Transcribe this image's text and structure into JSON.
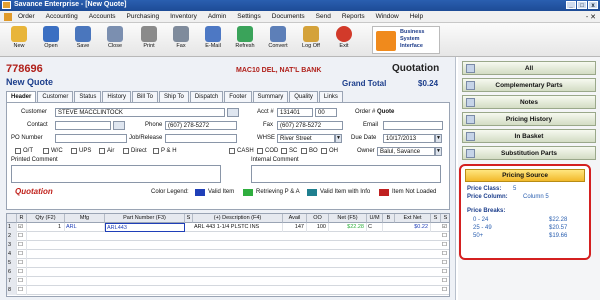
{
  "window": {
    "title": "Savance Enterprise - [New Quote]",
    "controls": [
      "_",
      "□",
      "x"
    ]
  },
  "menu": [
    "Order",
    "Accounting",
    "Accounts",
    "Purchasing",
    "Inventory",
    "Admin",
    "Settings",
    "Documents",
    "Send",
    "Reports",
    "Window",
    "Help"
  ],
  "menu_right": "- ✕",
  "toolbar": [
    {
      "label": "New",
      "icon": "new-doc-icon",
      "color": "#e8b53a"
    },
    {
      "label": "Open",
      "icon": "open-folder-icon",
      "color": "#3b6fc2"
    },
    {
      "label": "Save",
      "icon": "save-icon",
      "color": "#4a76bd"
    },
    {
      "label": "Close",
      "icon": "close-doc-icon",
      "color": "#7b8fb0"
    },
    {
      "label": "Print",
      "icon": "printer-icon",
      "color": "#8a8a8a"
    },
    {
      "label": "Fax",
      "icon": "fax-icon",
      "color": "#7f8b9c"
    },
    {
      "label": "E-Mail",
      "icon": "email-icon",
      "color": "#4d78c4"
    },
    {
      "label": "Refresh",
      "icon": "refresh-icon",
      "color": "#3aa35a"
    },
    {
      "label": "Convert",
      "icon": "convert-icon",
      "color": "#5d7fb8"
    },
    {
      "label": "Log Off",
      "icon": "logoff-icon",
      "color": "#d4a23a"
    },
    {
      "label": "Exit",
      "icon": "exit-icon",
      "color": "#d23a2a"
    }
  ],
  "logo_text": "Business System Interface",
  "header": {
    "quote_number": "778696",
    "title": "New Quote",
    "customer_banner": "MAC10   DEL, NAT'L BANK",
    "doc_type": "Quotation",
    "grand_total_label": "Grand Total",
    "grand_total": "$0.24"
  },
  "tabs": [
    "Header",
    "Customer",
    "Status",
    "History",
    "Bill To",
    "Ship To",
    "Dispatch",
    "Footer",
    "Summary",
    "Quality",
    "Links"
  ],
  "form": {
    "customer_label": "Customer",
    "customer": "STEVE MACCLINTOCK",
    "contact_label": "Contact",
    "contact": "",
    "phone_label": "Phone",
    "phone": "(607) 278-5272",
    "po_label": "PO Number",
    "po": "",
    "job_label": "Job/Release",
    "job": "",
    "acct_label": "Acct #",
    "acct": "131401",
    "acct_sub": "00",
    "order_label": "Order #",
    "order": "Quote",
    "fax_label": "Fax",
    "fax": "(607) 278-5272",
    "email_label": "Email",
    "email": "",
    "whse_label": "WHSE",
    "whse": "River Street",
    "due_label": "Due Date",
    "due": "10/17/2013",
    "owner_label": "Owner",
    "owner": "Balul, Savance",
    "ship_checks": [
      "O/T",
      "W/C",
      "UPS",
      "Air",
      "Direct",
      "P & H"
    ],
    "pay_checks": [
      "CASH",
      "COD",
      "SC",
      "BO",
      "OH"
    ],
    "printed_comment_label": "Printed Comment",
    "internal_comment_label": "Internal Comment",
    "doc_label": "Quotation"
  },
  "legend": {
    "label": "Color Legend:",
    "items": [
      {
        "text": "Valid Item",
        "color": "#1f3fb8"
      },
      {
        "text": "Retrieving P & A",
        "color": "#2fae3e"
      },
      {
        "text": "Valid Item with Info",
        "color": "#1f7f8f"
      },
      {
        "text": "Item Not Loaded",
        "color": "#c02020"
      }
    ]
  },
  "grid": {
    "columns": [
      "R",
      "Qty (F2)",
      "Mfg",
      "Part Number (F3)",
      "S",
      "(+) Description (F4)",
      "Avail",
      "OO",
      "Net (F5)",
      "U/M",
      "B",
      "Ext Net",
      "S",
      "S"
    ],
    "rows": [
      {
        "num": "1",
        "qty": "1",
        "mfg": "ARL",
        "part": "ARL443",
        "desc": "ARL 443 1-1/4 PLSTC INS",
        "avail": "147",
        "oo": "100",
        "net": "$22.28",
        "um": "C",
        "ext": "$0.22"
      },
      {
        "num": "2"
      },
      {
        "num": "3"
      },
      {
        "num": "4"
      },
      {
        "num": "5"
      },
      {
        "num": "6"
      },
      {
        "num": "7"
      },
      {
        "num": "8"
      }
    ]
  },
  "side": {
    "buttons": [
      "All",
      "Complementary Parts",
      "Notes",
      "Pricing History",
      "In Basket",
      "Substitution Parts"
    ],
    "pricing_source": {
      "title": "Pricing Source",
      "class_label": "Price Class:",
      "class_value": "5",
      "column_label": "Price Column:",
      "column_value": "Column 5",
      "breaks_label": "Price Breaks:",
      "breaks": [
        {
          "range": "0 - 24",
          "price": "$22.28"
        },
        {
          "range": "25 - 49",
          "price": "$20.57"
        },
        {
          "range": "50+",
          "price": "$19.66"
        }
      ]
    }
  }
}
